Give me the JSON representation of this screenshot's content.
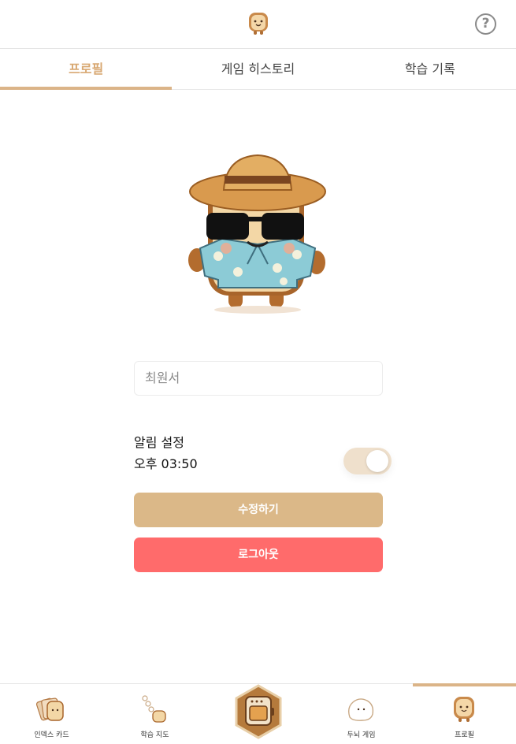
{
  "header": {
    "logo_icon": "toast-logo-icon",
    "help_icon": "help-circle-icon",
    "help_glyph": "?"
  },
  "tabs": [
    {
      "label": "프로필",
      "active": true
    },
    {
      "label": "게임 히스토리",
      "active": false
    },
    {
      "label": "학습 기록",
      "active": false
    }
  ],
  "profile": {
    "avatar_icon": "toast-character-sunglasses-hat",
    "name_value": "최원서",
    "notification": {
      "label": "알림 설정",
      "time": "오후 03:50",
      "enabled": true
    }
  },
  "actions": {
    "edit_label": "수정하기",
    "logout_label": "로그아웃"
  },
  "bottom_nav": [
    {
      "label": "인덱스 카드",
      "icon": "index-cards-icon",
      "active": false
    },
    {
      "label": "학습 지도",
      "icon": "study-map-icon",
      "active": false
    },
    {
      "label": "",
      "icon": "toaster-center-icon",
      "active": false
    },
    {
      "label": "두뇌 게임",
      "icon": "brain-game-icon",
      "active": false
    },
    {
      "label": "프로필",
      "icon": "profile-toast-icon",
      "active": true
    }
  ],
  "colors": {
    "accent": "#dbb488",
    "accent_text": "#d8a872",
    "edit_button": "#dbb888",
    "logout_button": "#ff6b6b",
    "toggle_track": "#efe0cc"
  }
}
